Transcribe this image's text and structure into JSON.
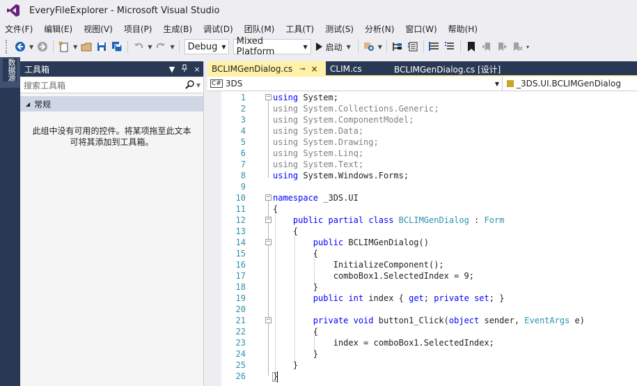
{
  "window": {
    "title": "EveryFileExplorer - Microsoft Visual Studio"
  },
  "menu": [
    "文件(F)",
    "编辑(E)",
    "视图(V)",
    "项目(P)",
    "生成(B)",
    "调试(D)",
    "团队(M)",
    "工具(T)",
    "测试(S)",
    "分析(N)",
    "窗口(W)",
    "帮助(H)"
  ],
  "toolbar": {
    "config": "Debug",
    "platform": "Mixed Platform",
    "start": "启动"
  },
  "side_strip": {
    "label": "数据源"
  },
  "toolbox": {
    "title": "工具箱",
    "pin": "ᵖ",
    "close": "×",
    "search_placeholder": "搜索工具箱",
    "group": "常规",
    "empty_message": "此组中没有可用的控件。将某项拖至此文本可将其添加到工具箱。",
    "empty_message_line1": "此组中没有可用的控件。将某项拖至此文本",
    "empty_message_line2": "可将其添加到工具箱。"
  },
  "tabs": [
    {
      "label": "BCLIMGenDialog.cs",
      "active": true
    },
    {
      "label": "CLIM.cs",
      "active": false
    },
    {
      "label": "BCLIMGenDialog.cs [设计]",
      "active": false
    }
  ],
  "navbar": {
    "project": "3DS",
    "member": "_3DS.UI.BCLIMGenDialog"
  },
  "code_lines": [
    {
      "n": "1",
      "text": "using System;"
    },
    {
      "n": "2",
      "text": "using System.Collections.Generic;"
    },
    {
      "n": "3",
      "text": "using System.ComponentModel;"
    },
    {
      "n": "4",
      "text": "using System.Data;"
    },
    {
      "n": "5",
      "text": "using System.Drawing;"
    },
    {
      "n": "6",
      "text": "using System.Linq;"
    },
    {
      "n": "7",
      "text": "using System.Text;"
    },
    {
      "n": "8",
      "text": "using System.Windows.Forms;"
    },
    {
      "n": "9",
      "text": ""
    },
    {
      "n": "10",
      "text": "namespace _3DS.UI"
    },
    {
      "n": "11",
      "text": "{"
    },
    {
      "n": "12",
      "text": "    public partial class BCLIMGenDialog : Form"
    },
    {
      "n": "13",
      "text": "    {"
    },
    {
      "n": "14",
      "text": "        public BCLIMGenDialog()"
    },
    {
      "n": "15",
      "text": "        {"
    },
    {
      "n": "16",
      "text": "            InitializeComponent();"
    },
    {
      "n": "17",
      "text": "            comboBox1.SelectedIndex = 9;"
    },
    {
      "n": "18",
      "text": "        }"
    },
    {
      "n": "19",
      "text": "        public int index { get; private set; }"
    },
    {
      "n": "20",
      "text": ""
    },
    {
      "n": "21",
      "text": "        private void button1_Click(object sender, EventArgs e)"
    },
    {
      "n": "22",
      "text": "        {"
    },
    {
      "n": "23",
      "text": "            index = comboBox1.SelectedIndex;"
    },
    {
      "n": "24",
      "text": "        }"
    },
    {
      "n": "25",
      "text": "    }"
    },
    {
      "n": "26",
      "text": "}"
    }
  ],
  "colors": {
    "keyword": "#0000ff",
    "type": "#2b91af",
    "dimmed": "#808080",
    "line_number": "#2b91af",
    "active_tab": "#fff1a7",
    "chrome_dark": "#293955"
  }
}
